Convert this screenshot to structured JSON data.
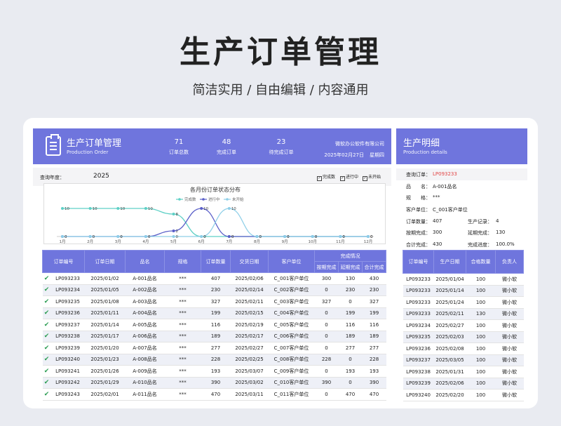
{
  "hero": {
    "title": "生产订单管理",
    "subtitle": "简洁实用 / 自由编辑 / 内容通用"
  },
  "left_header": {
    "title": "生产订单管理",
    "subtitle_en": "Production Order",
    "stats": [
      {
        "value": "71",
        "label": "订单总数"
      },
      {
        "value": "48",
        "label": "完成订单"
      },
      {
        "value": "23",
        "label": "待完成订单"
      }
    ],
    "company": "微软办公软件有限公司",
    "date": "2025年02月27日",
    "weekday": "星期四"
  },
  "query": {
    "label": "查询年度：",
    "value": "2025",
    "legend": [
      "完成数",
      "进行中",
      "未开始"
    ]
  },
  "chart_data": {
    "type": "line",
    "title": "各月份订单状态分布",
    "categories": [
      "1月",
      "2月",
      "3月",
      "4月",
      "5月",
      "6月",
      "7月",
      "8月",
      "9月",
      "10月",
      "11月",
      "12月"
    ],
    "ylim": [
      0,
      10
    ],
    "legend_position": "top-right",
    "series": [
      {
        "name": "完成数",
        "color": "#5fd0c6",
        "values": [
          10,
          10,
          10,
          10,
          8,
          0,
          0,
          0,
          0,
          0,
          0,
          0
        ],
        "labels": [
          "10",
          "10",
          "10",
          "10",
          "8",
          "0",
          "0",
          "0",
          "0",
          "0",
          "0",
          "0"
        ]
      },
      {
        "name": "进行中",
        "color": "#5a5fc8",
        "values": [
          0,
          0,
          0,
          0,
          2,
          10,
          0,
          0,
          0,
          0,
          0,
          0
        ],
        "labels": [
          "0",
          "0",
          "0",
          "0",
          "2",
          "10",
          "0",
          "0",
          "0",
          "0",
          "0",
          "0"
        ]
      },
      {
        "name": "未开始",
        "color": "#8fcfe8",
        "values": [
          0,
          0,
          0,
          0,
          0,
          0,
          10,
          0,
          0,
          0,
          0,
          0
        ],
        "labels": [
          "0",
          "0",
          "0",
          "0",
          "0",
          "0",
          "10",
          "0",
          "0",
          "0",
          "0",
          "0"
        ]
      }
    ]
  },
  "orders": {
    "headers": [
      "订单编号",
      "订单日期",
      "品名",
      "规格",
      "订单数量",
      "交货日期",
      "客户单位"
    ],
    "group_header": "完成情况",
    "sub_headers": [
      "按期完成",
      "延期完成",
      "合计完成"
    ],
    "rows": [
      [
        "✔",
        "LP093233",
        "2025/01/02",
        "A-001品名",
        "***",
        "407",
        "2025/02/06",
        "C_001客户单位",
        "300",
        "130",
        "430"
      ],
      [
        "✔",
        "LP093234",
        "2025/01/05",
        "A-002品名",
        "***",
        "230",
        "2025/02/14",
        "C_002客户单位",
        "0",
        "230",
        "230"
      ],
      [
        "✔",
        "LP093235",
        "2025/01/08",
        "A-003品名",
        "***",
        "327",
        "2025/02/11",
        "C_003客户单位",
        "327",
        "0",
        "327"
      ],
      [
        "✔",
        "LP093236",
        "2025/01/11",
        "A-004品名",
        "***",
        "199",
        "2025/02/15",
        "C_004客户单位",
        "0",
        "199",
        "199"
      ],
      [
        "✔",
        "LP093237",
        "2025/01/14",
        "A-005品名",
        "***",
        "116",
        "2025/02/19",
        "C_005客户单位",
        "0",
        "116",
        "116"
      ],
      [
        "✔",
        "LP093238",
        "2025/01/17",
        "A-006品名",
        "***",
        "189",
        "2025/02/17",
        "C_006客户单位",
        "0",
        "189",
        "189"
      ],
      [
        "✔",
        "LP093239",
        "2025/01/20",
        "A-007品名",
        "***",
        "277",
        "2025/02/27",
        "C_007客户单位",
        "0",
        "277",
        "277"
      ],
      [
        "✔",
        "LP093240",
        "2025/01/23",
        "A-008品名",
        "***",
        "228",
        "2025/02/25",
        "C_008客户单位",
        "228",
        "0",
        "228"
      ],
      [
        "✔",
        "LP093241",
        "2025/01/26",
        "A-009品名",
        "***",
        "193",
        "2025/03/07",
        "C_009客户单位",
        "0",
        "193",
        "193"
      ],
      [
        "✔",
        "LP093242",
        "2025/01/29",
        "A-010品名",
        "***",
        "390",
        "2025/03/02",
        "C_010客户单位",
        "390",
        "0",
        "390"
      ],
      [
        "✔",
        "LP093243",
        "2025/02/01",
        "A-011品名",
        "***",
        "470",
        "2025/03/11",
        "C_011客户单位",
        "0",
        "470",
        "470"
      ]
    ]
  },
  "right_header": {
    "title": "生产明细",
    "subtitle_en": "Production details"
  },
  "details": {
    "query_order_label": "查询订单：",
    "query_order_value": "LP093233",
    "name_label": "品　　名：",
    "name_value": "A-001品名",
    "spec_label": "规　　格：",
    "spec_value": "***",
    "customer_label": "客户单位：",
    "customer_value": "C_001客户单位",
    "order_qty_label": "订单数量：",
    "order_qty_value": "407",
    "records_label": "生产记录：",
    "records_value": "4",
    "ontime_label": "按期完成：",
    "ontime_value": "300",
    "late_label": "延期完成：",
    "late_value": "130",
    "total_label": "合计完成：",
    "total_value": "430",
    "progress_label": "完成进度：",
    "progress_value": "100.0%"
  },
  "production": {
    "headers": [
      "订单编号",
      "生产日期",
      "合格数量",
      "负责人"
    ],
    "rows": [
      [
        "LP093233",
        "2025/01/04",
        "100",
        "微小软"
      ],
      [
        "LP093233",
        "2025/01/14",
        "100",
        "微小软"
      ],
      [
        "LP093233",
        "2025/01/24",
        "100",
        "微小软"
      ],
      [
        "LP093233",
        "2025/02/11",
        "130",
        "微小软"
      ],
      [
        "LP093234",
        "2025/02/27",
        "100",
        "微小软"
      ],
      [
        "LP093235",
        "2025/02/03",
        "100",
        "微小软"
      ],
      [
        "LP093236",
        "2025/02/08",
        "100",
        "微小软"
      ],
      [
        "LP093237",
        "2025/03/05",
        "100",
        "微小软"
      ],
      [
        "LP093238",
        "2025/01/31",
        "100",
        "微小软"
      ],
      [
        "LP093239",
        "2025/02/06",
        "100",
        "微小软"
      ],
      [
        "LP093240",
        "2025/02/20",
        "100",
        "微小软"
      ]
    ]
  }
}
